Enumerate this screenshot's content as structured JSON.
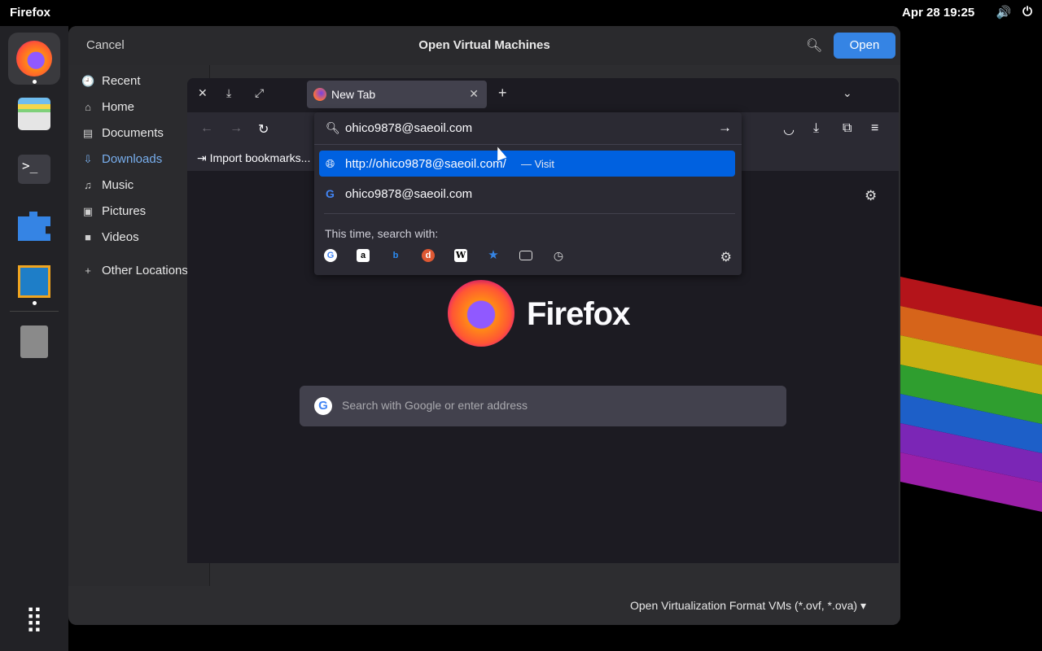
{
  "topbar": {
    "app_name": "Firefox",
    "clock": "Apr 28  19:25",
    "volume_icon": "🔊",
    "power_icon": "⏻"
  },
  "dock": {
    "apps": [
      "firefox-icon",
      "files-icon",
      "terminal-icon",
      "extensions-icon",
      "virtualbox-icon",
      "trash-icon",
      "app-grid-icon"
    ]
  },
  "file_dialog": {
    "cancel": "Cancel",
    "title": "Open Virtual Machines",
    "open": "Open",
    "places": [
      {
        "label": "Recent",
        "icon": "🕘"
      },
      {
        "label": "Home",
        "icon": "⌂"
      },
      {
        "label": "Documents",
        "icon": "▤"
      },
      {
        "label": "Downloads",
        "icon": "⇩"
      },
      {
        "label": "Music",
        "icon": "♫"
      },
      {
        "label": "Pictures",
        "icon": "▣"
      },
      {
        "label": "Videos",
        "icon": "■"
      },
      {
        "label": "Other Locations",
        "icon": "+"
      }
    ],
    "filter": "Open Virtualization Format VMs (*.ovf, *.ova) ▾"
  },
  "firefox": {
    "tab_label": "New Tab",
    "import_bookmarks": "Import bookmarks...",
    "brand": "Firefox",
    "search_placeholder": "Search with Google or enter address",
    "urlbar_value": "ohico9878@saeoil.com",
    "results": [
      {
        "text": "http://ohico9878@saeoil.com/",
        "action": "—  Visit"
      },
      {
        "text": "ohico9878@saeoil.com"
      }
    ],
    "search_with": "This time, search with:"
  }
}
